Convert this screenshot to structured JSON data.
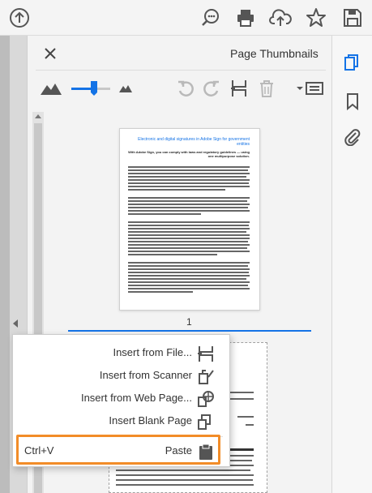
{
  "toolbar": {
    "icons": [
      "upload-circle-icon",
      "search-comment-icon",
      "print-icon",
      "cloud-upload-icon",
      "star-icon",
      "save-icon"
    ]
  },
  "pane": {
    "title": "Page Thumbnails",
    "page_number": "1",
    "tools": [
      "enlarge-thumbnails-icon",
      "thumbnail-size-slider",
      "reduce-thumbnails-icon",
      "rotate-left-icon",
      "rotate-right-icon",
      "insert-pages-icon",
      "delete-icon",
      "options-menu-icon"
    ]
  },
  "thumbnail": {
    "title": "Electronic and digital signatures in Adobe Sign for government entities",
    "subtitle": "With Adobe Sign, you can comply with laws and regulatory guidelines — using one multipurpose solution."
  },
  "context_menu": {
    "items": [
      {
        "label": "Insert from File...",
        "icon": "insert-file-icon"
      },
      {
        "label": "Insert from Scanner",
        "icon": "scanner-icon"
      },
      {
        "label": "Insert from Web Page...",
        "icon": "web-page-icon"
      },
      {
        "label": "Insert Blank Page",
        "icon": "blank-page-icon"
      },
      {
        "label": "Paste",
        "icon": "clipboard-icon",
        "shortcut": "Ctrl+V"
      }
    ]
  },
  "right_sidebar": {
    "icons": [
      "pages-icon",
      "bookmark-icon",
      "attachment-icon"
    ]
  },
  "colors": {
    "accent": "#1473e6",
    "highlight": "#f28c28"
  }
}
